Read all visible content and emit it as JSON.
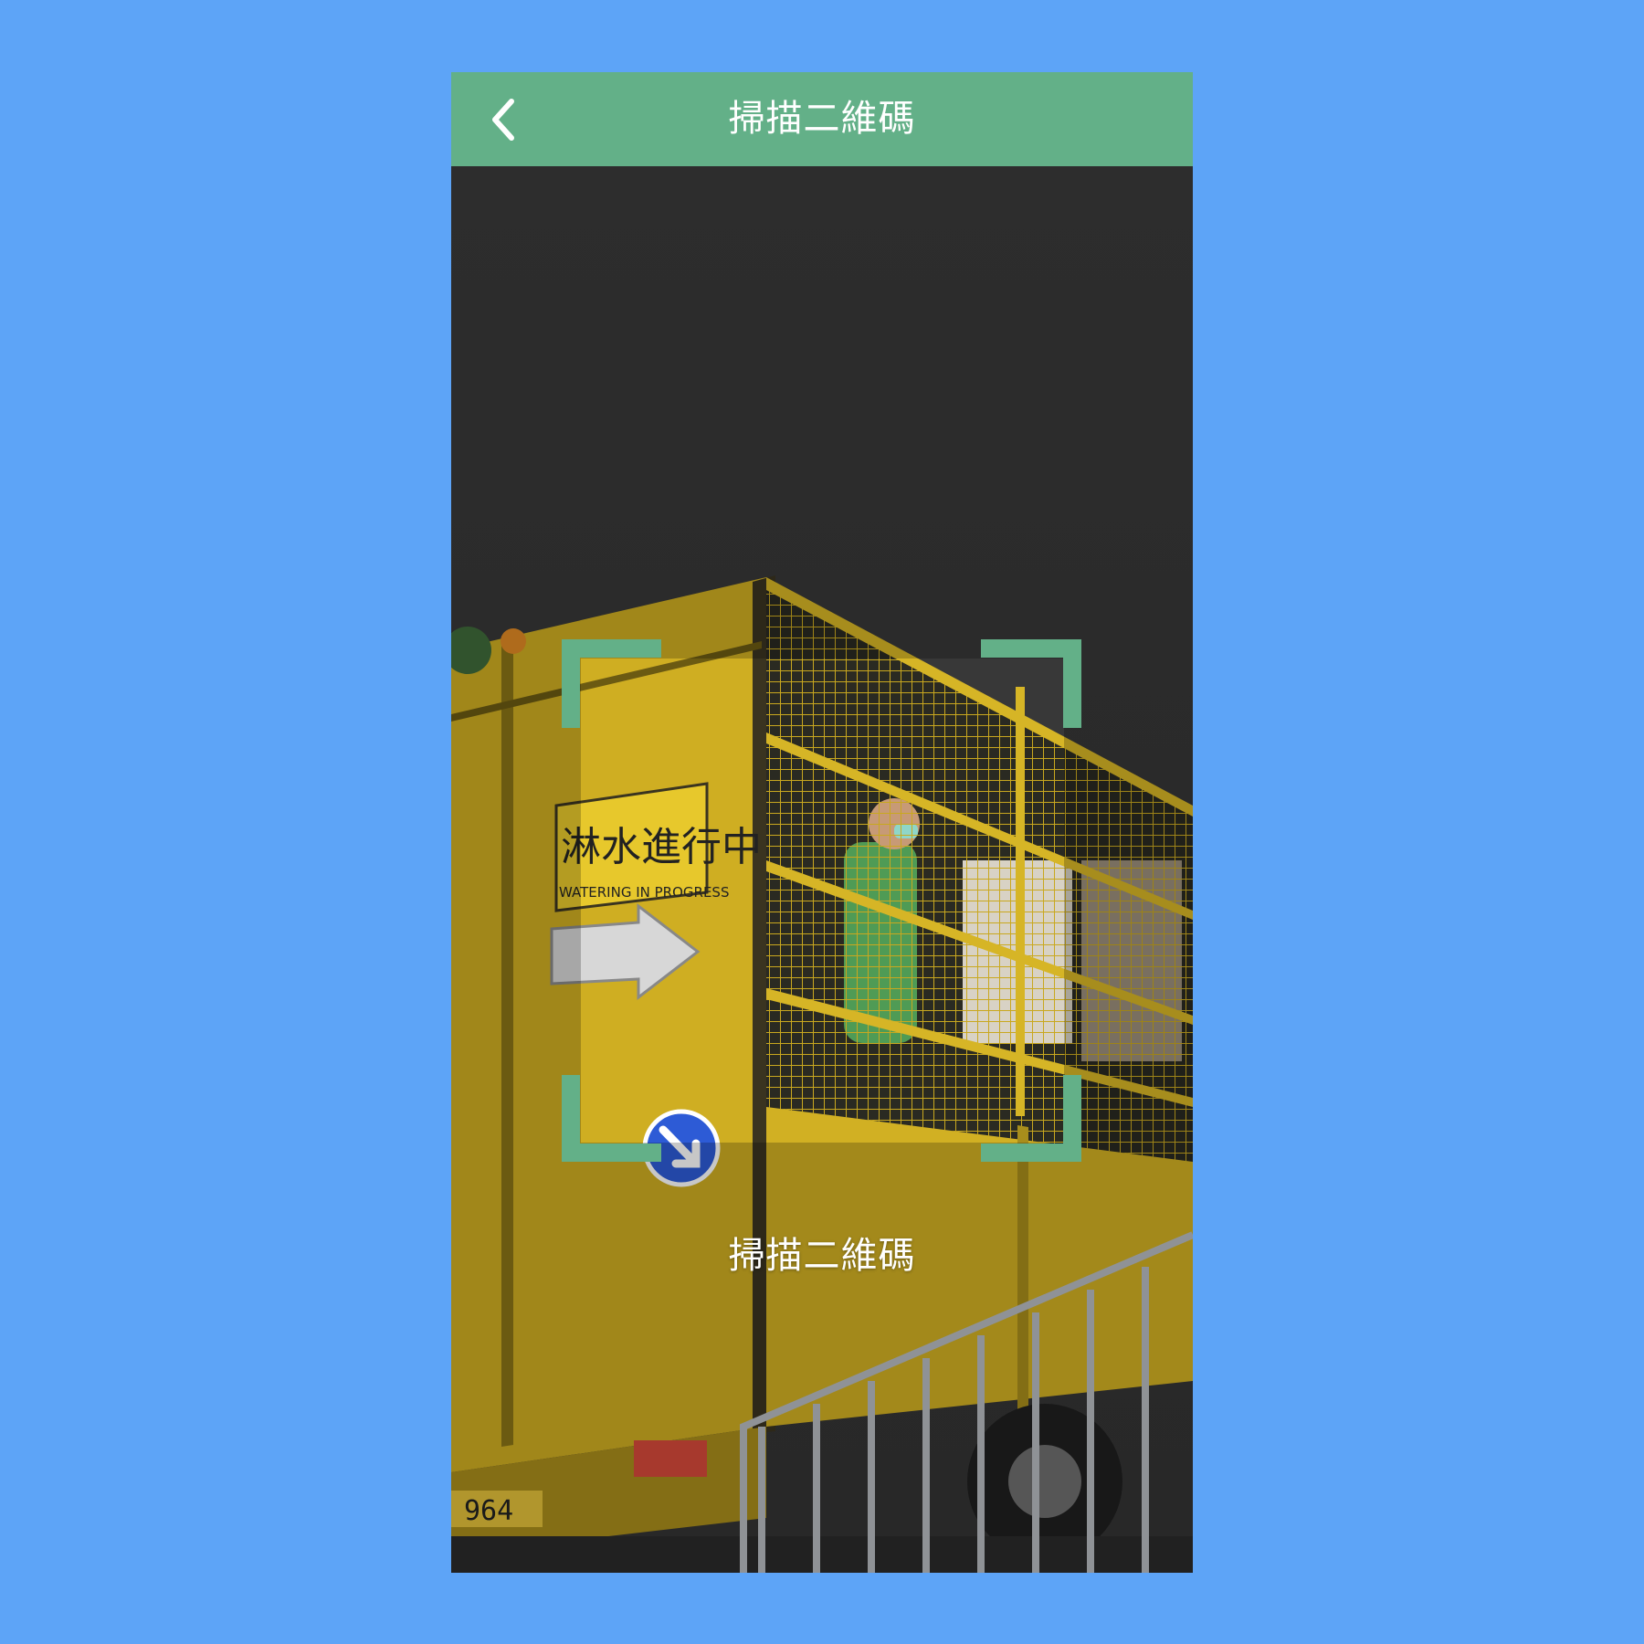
{
  "header": {
    "back_icon": "chevron-left-icon",
    "title": "掃描二維碼"
  },
  "viewfinder": {
    "caption": "掃描二維碼",
    "frame_color": "#63b088"
  },
  "camera_scene": {
    "sign_chinese": "淋水進行中",
    "sign_english": "WATERING IN PROGRESS",
    "plate_number": "964"
  },
  "colors": {
    "page_background": "#5da4f7",
    "header_background": "#63b088",
    "truck_yellow": "#d6b526"
  }
}
